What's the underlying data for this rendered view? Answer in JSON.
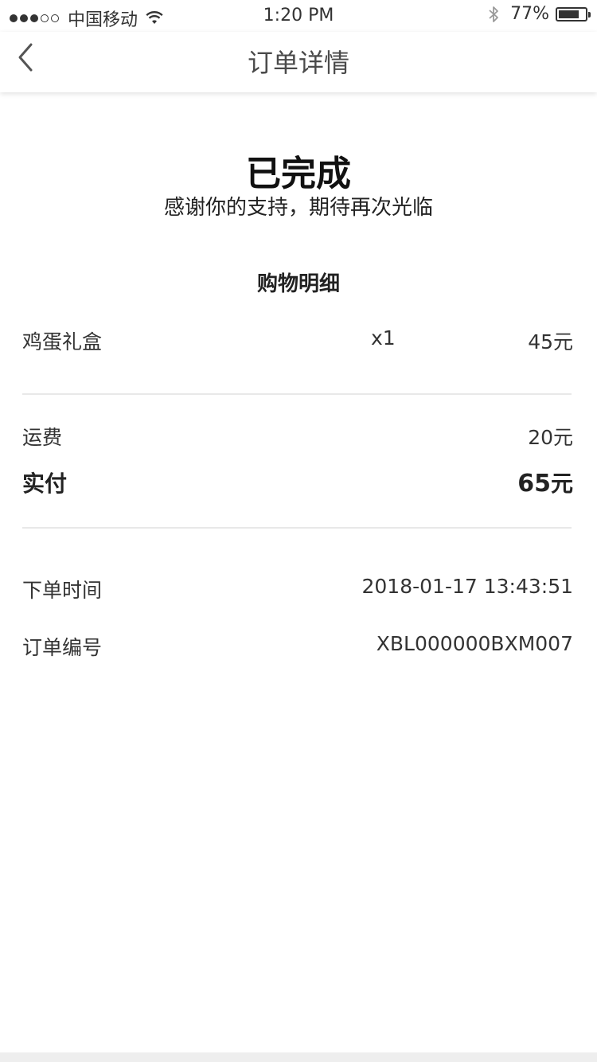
{
  "status_bar": {
    "carrier": "中国移动",
    "time": "1:20 PM",
    "battery": "77%",
    "battery_level": 0.77,
    "signal_bars_filled": 3,
    "signal_bars_total": 5,
    "icons": [
      "signal-dots-icon",
      "wifi-icon",
      "bluetooth-icon",
      "battery-icon"
    ]
  },
  "nav": {
    "title": "订单详情",
    "back_icon": "chevron-left-icon"
  },
  "order_status": {
    "title": "已完成",
    "subtitle": "感谢你的支持，期待再次光临"
  },
  "details": {
    "section_title": "购物明细",
    "items": [
      {
        "name": "鸡蛋礼盒",
        "quantity": "x1",
        "price": "45元"
      }
    ],
    "shipping_label": "运费",
    "shipping_value": "20元",
    "paid_label": "实付",
    "paid_amount": "65",
    "paid_unit": "元"
  },
  "info": {
    "order_time_label": "下单时间",
    "order_time_value": "2018-01-17 13:43:51",
    "order_no_label": "订单编号",
    "order_no_value": "XBL000000BXM007"
  },
  "colors": {
    "background": "#ffffff",
    "text_primary": "#333333",
    "divider": "#e8e8e8"
  }
}
